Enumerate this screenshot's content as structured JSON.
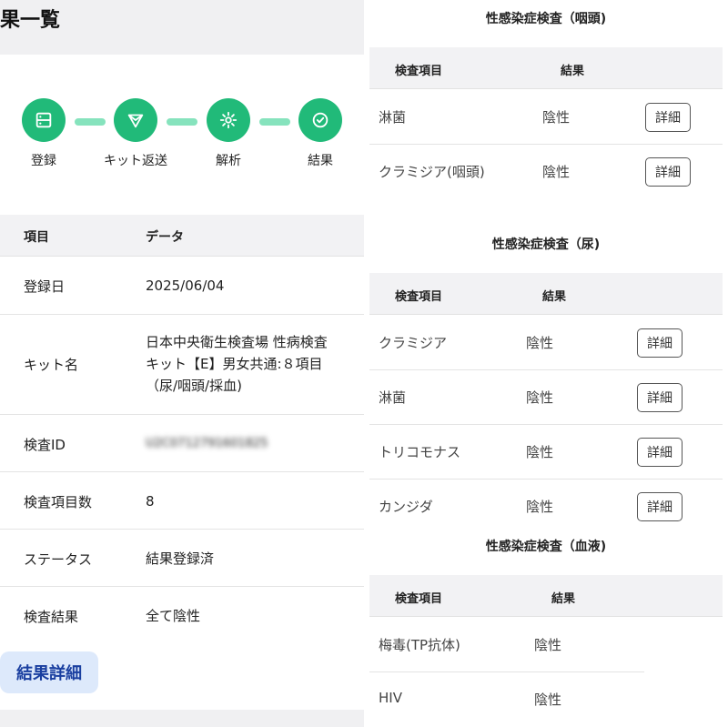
{
  "page_title": "果一覧",
  "steps": [
    {
      "label": "登録",
      "icon": "server-icon"
    },
    {
      "label": "キット返送",
      "icon": "send-icon"
    },
    {
      "label": "解析",
      "icon": "gear-icon"
    },
    {
      "label": "結果",
      "icon": "check-circle-icon"
    }
  ],
  "info_table": {
    "header_key": "項目",
    "header_value": "データ",
    "rows": [
      {
        "key": "登録日",
        "value": "2025/06/04"
      },
      {
        "key": "キット名",
        "value_lines": [
          "日本中央衛生検査場 性病検査",
          "キット【E】男女共通:８項目",
          "（尿/咽頭/採血)"
        ]
      },
      {
        "key": "検査ID",
        "value": "U2C0712791601825"
      },
      {
        "key": "検査項目数",
        "value": "8"
      },
      {
        "key": "ステータス",
        "value": "結果登録済"
      },
      {
        "key": "検査結果",
        "value": "全て陰性"
      }
    ]
  },
  "result_detail_button": "結果詳細",
  "sections": [
    {
      "title": "性感染症検査（咽頭)",
      "col_item": "検査項目",
      "col_result": "結果",
      "rows": [
        {
          "item": "淋菌",
          "result": "陰性",
          "button": "詳細"
        },
        {
          "item": "クラミジア(咽頭)",
          "result": "陰性",
          "button": "詳細"
        }
      ]
    },
    {
      "title": "性感染症検査（尿)",
      "col_item": "検査項目",
      "col_result": "結果",
      "rows": [
        {
          "item": "クラミジア",
          "result": "陰性",
          "button": "詳細"
        },
        {
          "item": "淋菌",
          "result": "陰性",
          "button": "詳細"
        },
        {
          "item": "トリコモナス",
          "result": "陰性",
          "button": "詳細"
        },
        {
          "item": "カンジダ",
          "result": "陰性",
          "button": "詳細"
        }
      ]
    },
    {
      "title": "性感染症検査（血液)",
      "col_item": "検査項目",
      "col_result": "結果",
      "rows": [
        {
          "item": "梅毒(TP抗体)",
          "result": "陰性"
        },
        {
          "item": "HIV",
          "result": "陰性"
        }
      ]
    }
  ],
  "colors": {
    "step_green": "#21ba79",
    "step_line": "#86e3bd",
    "button_bg": "#dde9fb",
    "button_text": "#1a3fa0"
  }
}
